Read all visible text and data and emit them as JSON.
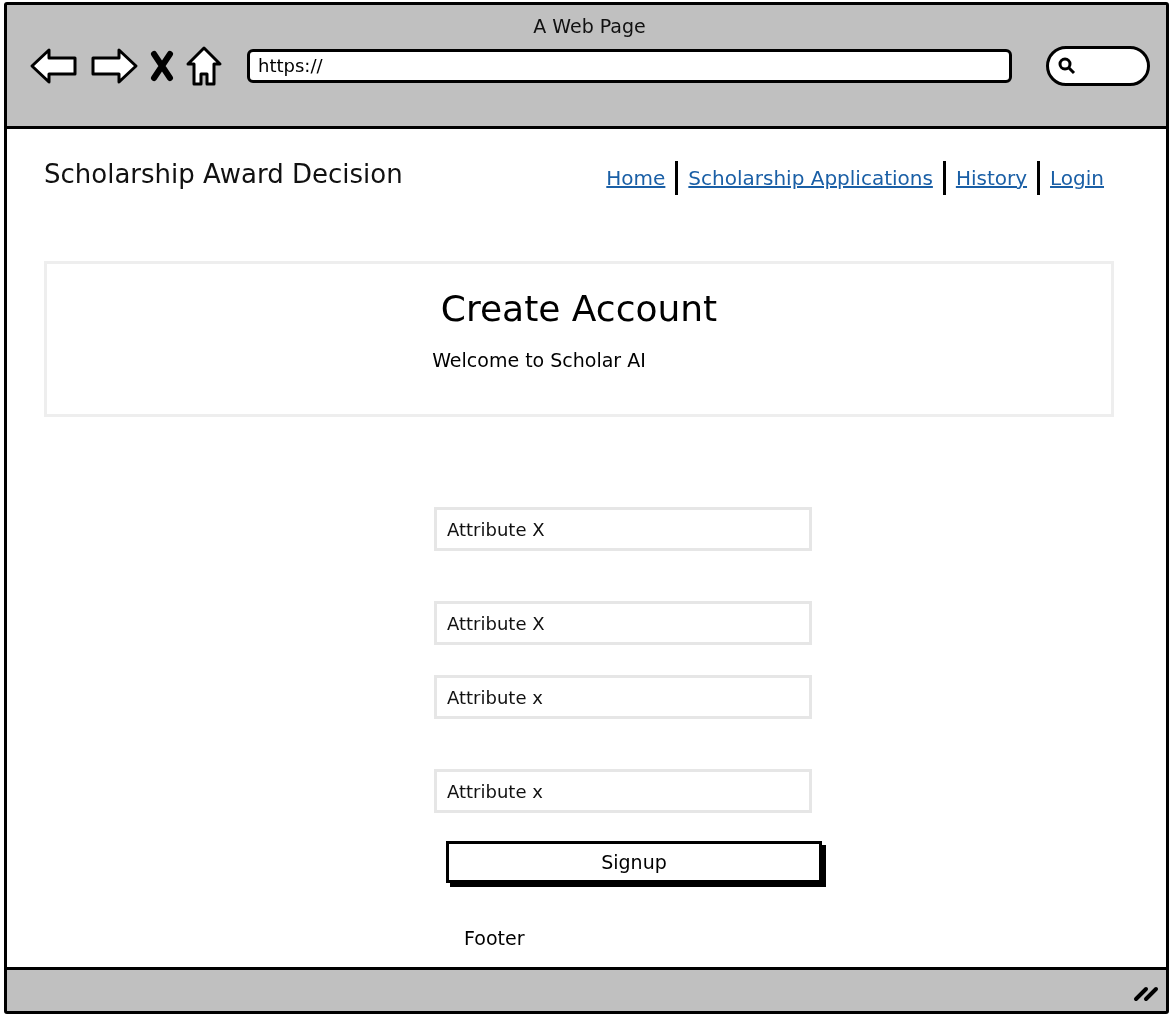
{
  "window": {
    "title": "A Web Page"
  },
  "browser": {
    "url": "https://"
  },
  "site": {
    "title": "Scholarship Award Decision",
    "nav": [
      {
        "label": "Home"
      },
      {
        "label": "Scholarship Applications"
      },
      {
        "label": "History"
      },
      {
        "label": "Login"
      }
    ]
  },
  "banner": {
    "title": "Create Account",
    "subtitle": "Welcome to Scholar AI"
  },
  "form": {
    "fields": [
      {
        "value": "Attribute X"
      },
      {
        "value": "Attribute X"
      },
      {
        "value": "Attribute x"
      },
      {
        "value": "Attribute x"
      }
    ],
    "button": "Signup"
  },
  "footer": "Footer"
}
